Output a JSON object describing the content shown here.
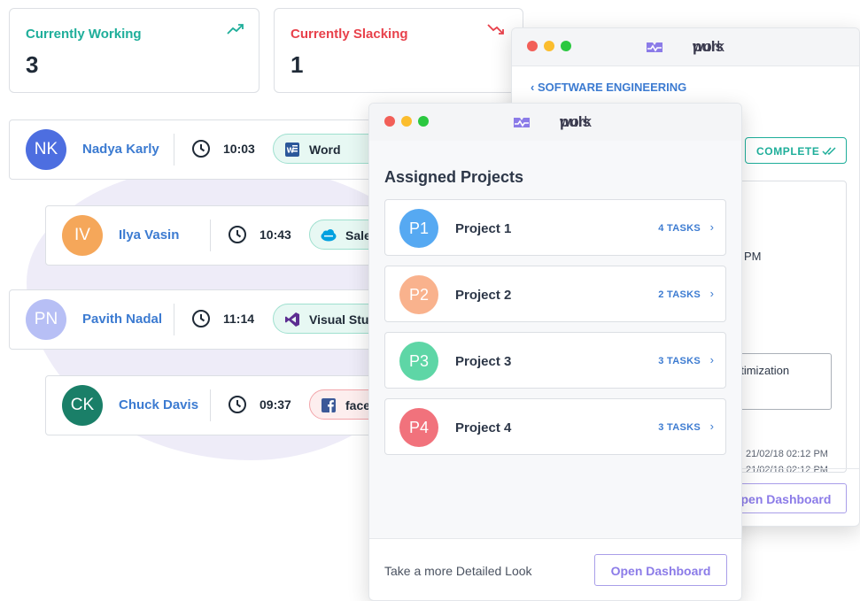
{
  "stats": [
    {
      "label": "Currently Working",
      "value": "3",
      "color": "#1eae9a",
      "trend": "up"
    },
    {
      "label": "Currently Slacking",
      "value": "1",
      "color": "#e8414b",
      "trend": "down"
    }
  ],
  "employees": [
    {
      "initials": "NK",
      "name": "Nadya Karly",
      "time": "10:03",
      "app": "Word",
      "app_icon": "word-icon",
      "avatar_color": "#4d6ee0",
      "pill_status": "productive"
    },
    {
      "initials": "IV",
      "name": "Ilya Vasin",
      "time": "10:43",
      "app": "Sale",
      "app_icon": "salesforce-icon",
      "avatar_color": "#f5a75a",
      "pill_status": "productive"
    },
    {
      "initials": "PN",
      "name": "Pavith Nadal",
      "time": "11:14",
      "app": "Visual Studi",
      "app_icon": "visual-studio-icon",
      "avatar_color": "#b7bff5",
      "pill_status": "productive"
    },
    {
      "initials": "CK",
      "name": "Chuck Davis",
      "time": "09:37",
      "app": "facel",
      "app_icon": "facebook-icon",
      "avatar_color": "#1a7f68",
      "pill_status": "unproductive"
    }
  ],
  "back_window": {
    "brand_light": "work",
    "brand_bold": "puls",
    "back_link": "SOFTWARE ENGINEERING",
    "status_badge": "COMPLETE",
    "partial_time": "PM",
    "partial_text": "ptimization",
    "timestamp_1": "21/02/18 02:12 PM",
    "timestamp_2": "21/02/18 02:12 PM",
    "button": "Open Dashboard"
  },
  "front_window": {
    "brand_light": "work",
    "brand_bold": "puls",
    "heading": "Assigned Projects",
    "projects": [
      {
        "code": "P1",
        "name": "Project 1",
        "tasks": "4 TASKS",
        "color": "#56a9f2"
      },
      {
        "code": "P2",
        "name": "Project 2",
        "tasks": "2 TASKS",
        "color": "#f9b28d"
      },
      {
        "code": "P3",
        "name": "Project 3",
        "tasks": "3 TASKS",
        "color": "#5ed6a6"
      },
      {
        "code": "P4",
        "name": "Project 4",
        "tasks": "3 TASKS",
        "color": "#f1727c"
      }
    ],
    "footer_text": "Take a more Detailed Look",
    "button": "Open Dashboard"
  },
  "colors": {
    "accent_blue": "#3c7bd1",
    "brand_purple": "#8b7be8",
    "mac_red": "#f25f58",
    "mac_yellow": "#fbbd2e",
    "mac_green": "#2bc840"
  }
}
